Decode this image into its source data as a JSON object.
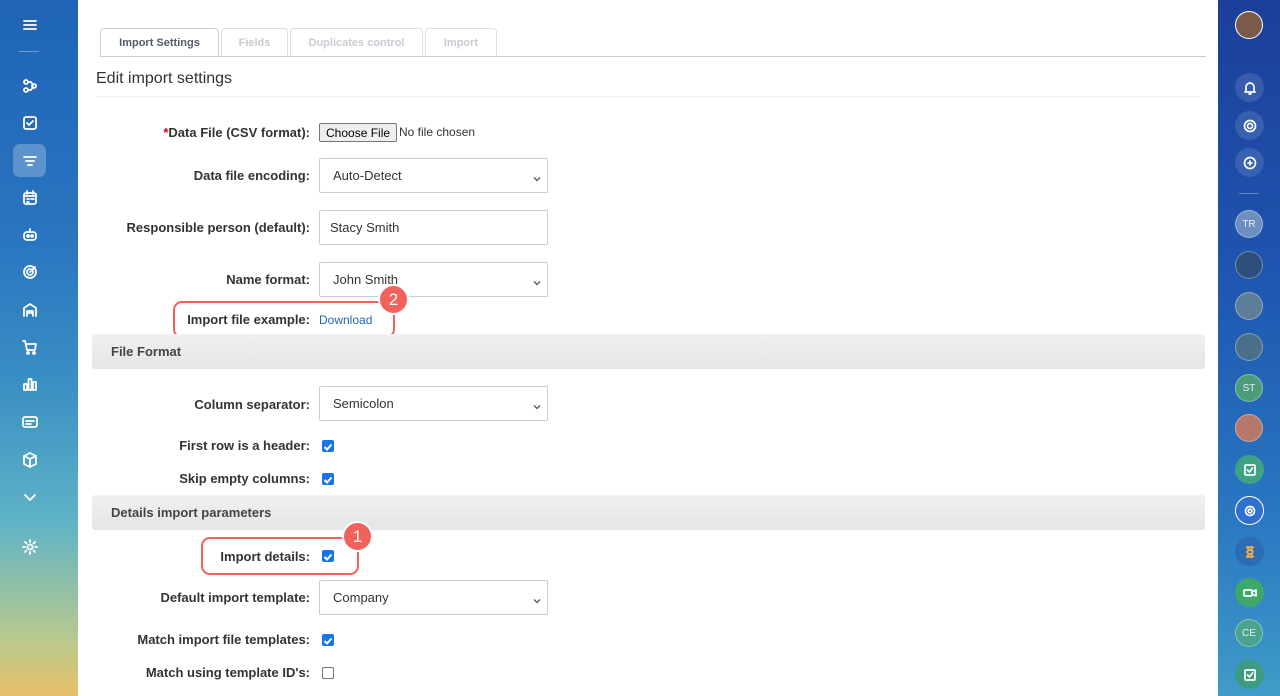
{
  "tabs": [
    {
      "label": "Import Settings",
      "active": true
    },
    {
      "label": "Fields",
      "active": false
    },
    {
      "label": "Duplicates control",
      "active": false
    },
    {
      "label": "Import",
      "active": false
    }
  ],
  "page_title": "Edit import settings",
  "form": {
    "data_file": {
      "required_mark": "*",
      "label": "Data File (CSV format):",
      "button": "Choose File",
      "status": "No file chosen"
    },
    "encoding": {
      "label": "Data file encoding:",
      "value": "Auto-Detect"
    },
    "responsible": {
      "label": "Responsible person (default):",
      "value": "Stacy Smith"
    },
    "name_format": {
      "label": "Name format:",
      "value": "John Smith"
    },
    "example": {
      "label": "Import file example:",
      "link": "Download"
    }
  },
  "file_format": {
    "title": "File Format",
    "separator": {
      "label": "Column separator:",
      "value": "Semicolon"
    },
    "first_row_header": {
      "label": "First row is a header:",
      "checked": true
    },
    "skip_empty": {
      "label": "Skip empty columns:",
      "checked": true
    }
  },
  "details": {
    "title": "Details import parameters",
    "import_details": {
      "label": "Import details:",
      "checked": true
    },
    "default_template": {
      "label": "Default import template:",
      "value": "Company"
    },
    "match_templates": {
      "label": "Match import file templates:",
      "checked": true
    },
    "match_ids": {
      "label": "Match using template ID's:",
      "checked": false
    }
  },
  "callouts": {
    "first": "1",
    "second": "2"
  },
  "left_nav": [
    "menu-icon",
    "flow-icon",
    "task-icon",
    "filter-icon",
    "calendar-icon",
    "robot-icon",
    "target-icon",
    "store-icon",
    "cart-icon",
    "analytics-icon",
    "contact-card-icon",
    "box-icon",
    "chevron-down-icon",
    "settings-icon"
  ],
  "right_bar": {
    "avatars": [
      "TR",
      "ST",
      "CE"
    ]
  },
  "colors": {
    "accent": "#f0625b",
    "link": "#2067b0",
    "checkbox": "#1a73e8"
  }
}
